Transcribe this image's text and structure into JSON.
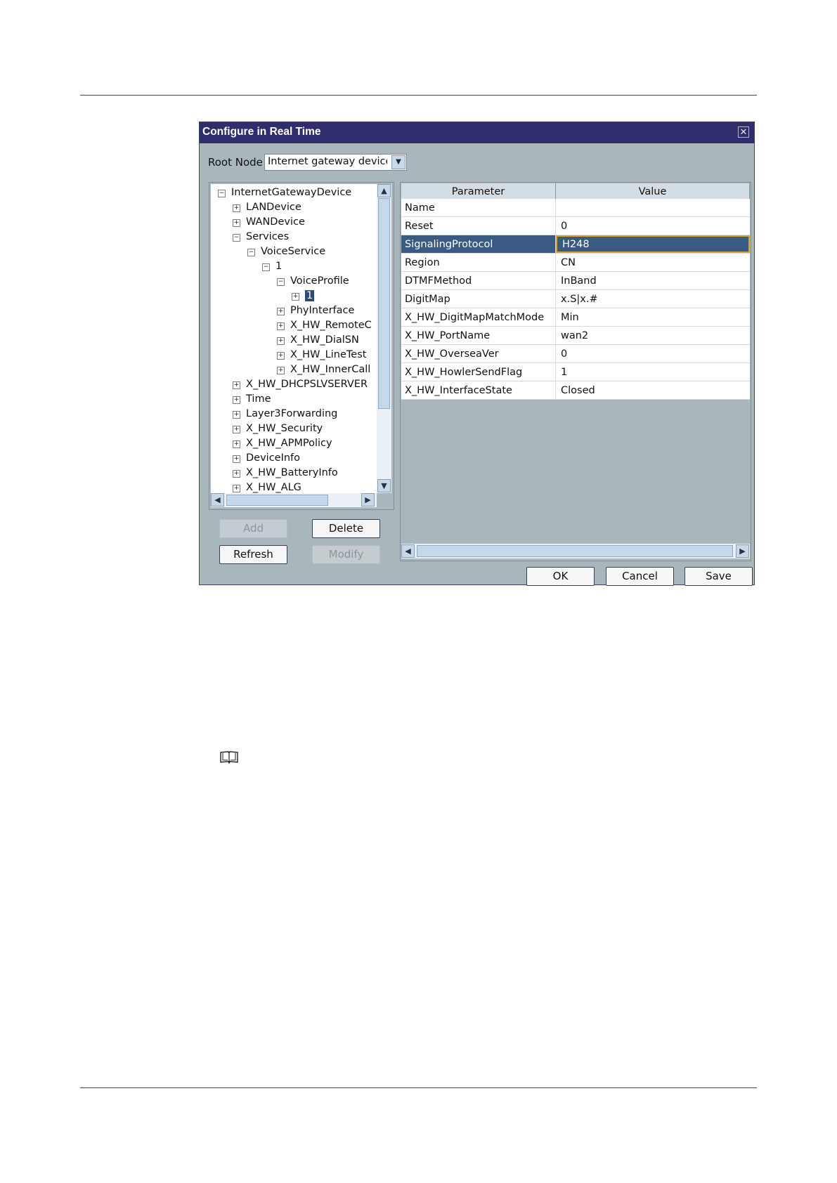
{
  "dialog": {
    "title": "Configure in Real Time",
    "close_symbol": "✕",
    "root_node": {
      "label": "Root Node",
      "value": "Internet gateway device"
    }
  },
  "tree": {
    "items": [
      {
        "label": "InternetGatewayDevice",
        "toggle": "−"
      },
      {
        "label": "LANDevice",
        "toggle": "+"
      },
      {
        "label": "WANDevice",
        "toggle": "+"
      },
      {
        "label": "Services",
        "toggle": "−"
      },
      {
        "label": "VoiceService",
        "toggle": "−"
      },
      {
        "label": "1",
        "toggle": "−"
      },
      {
        "label": "VoiceProfile",
        "toggle": "−"
      },
      {
        "label": "1",
        "toggle": "+",
        "selected": true
      },
      {
        "label": "PhyInterface",
        "toggle": "+"
      },
      {
        "label": "X_HW_RemoteC",
        "toggle": "+"
      },
      {
        "label": "X_HW_DialSN",
        "toggle": "+"
      },
      {
        "label": "X_HW_LineTest",
        "toggle": "+"
      },
      {
        "label": "X_HW_InnerCall",
        "toggle": "+"
      },
      {
        "label": "X_HW_DHCPSLVSERVER",
        "toggle": "+"
      },
      {
        "label": "Time",
        "toggle": "+"
      },
      {
        "label": "Layer3Forwarding",
        "toggle": "+"
      },
      {
        "label": "X_HW_Security",
        "toggle": "+"
      },
      {
        "label": "X_HW_APMPolicy",
        "toggle": "+"
      },
      {
        "label": "DeviceInfo",
        "toggle": "+"
      },
      {
        "label": "X_HW_BatteryInfo",
        "toggle": "+"
      },
      {
        "label": "X_HW_ALG",
        "toggle": "+"
      }
    ]
  },
  "buttons": {
    "add": "Add",
    "delete": "Delete",
    "refresh": "Refresh",
    "modify": "Modify",
    "ok": "OK",
    "cancel": "Cancel",
    "save": "Save"
  },
  "table": {
    "headers": [
      "Parameter",
      "Value"
    ],
    "rows": [
      {
        "parameter": "Name",
        "value": ""
      },
      {
        "parameter": "Reset",
        "value": "0"
      },
      {
        "parameter": "SignalingProtocol",
        "value": "H248",
        "selected": true
      },
      {
        "parameter": "Region",
        "value": "CN"
      },
      {
        "parameter": "DTMFMethod",
        "value": "InBand"
      },
      {
        "parameter": "DigitMap",
        "value": "x.S|x.#"
      },
      {
        "parameter": "X_HW_DigitMapMatchMode",
        "value": "Min"
      },
      {
        "parameter": "X_HW_PortName",
        "value": "wan2"
      },
      {
        "parameter": "X_HW_OverseaVer",
        "value": "0"
      },
      {
        "parameter": "X_HW_HowlerSendFlag",
        "value": "1"
      },
      {
        "parameter": "X_HW_InterfaceState",
        "value": "Closed"
      }
    ]
  },
  "scroll_glyphs": {
    "up": "▲",
    "down": "▼",
    "left": "◀",
    "right": "▶",
    "grip": "≡"
  },
  "icons": {
    "note": "book-icon",
    "close": "close-icon",
    "dropdown": "chevron-down-icon"
  },
  "colors": {
    "title_bar": "#2e2d6e",
    "dialog_bg": "#a9b7bd",
    "selected_row": "#3a5a83",
    "focus_border": "#d9a326"
  }
}
